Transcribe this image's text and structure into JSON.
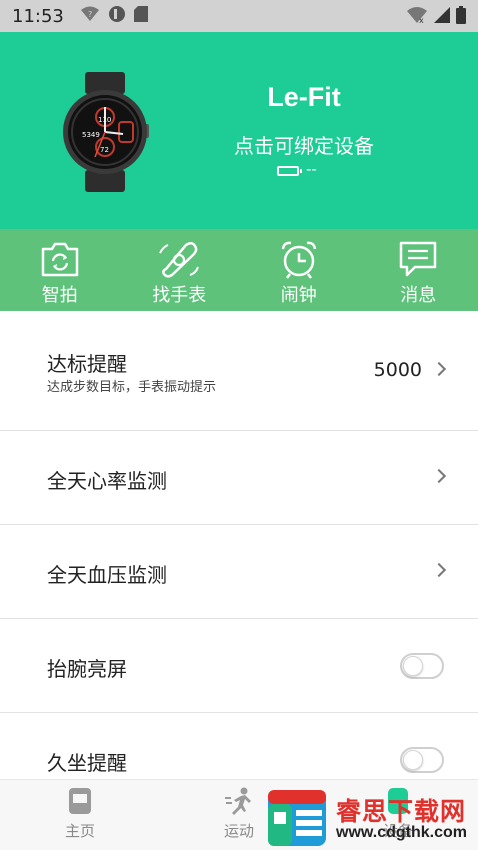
{
  "status_bar": {
    "time": "11:53"
  },
  "header": {
    "title": "Le-Fit",
    "subtitle": "点击可绑定设备",
    "battery_text": "--",
    "watch_face": {
      "top": "110",
      "steps": "5349",
      "bottom": "72"
    },
    "background": "#1ecc95"
  },
  "actions": [
    {
      "label": "智拍",
      "icon": "camera-icon"
    },
    {
      "label": "找手表",
      "icon": "find-watch-icon"
    },
    {
      "label": "闹钟",
      "icon": "alarm-clock-icon"
    },
    {
      "label": "消息",
      "icon": "message-icon"
    }
  ],
  "settings": {
    "goal": {
      "title": "达标提醒",
      "desc": "达成步数目标，手表振动提示",
      "value": "5000"
    },
    "heart_rate": {
      "title": "全天心率监测"
    },
    "blood_pressure": {
      "title": "全天血压监测"
    },
    "wrist_raise": {
      "title": "抬腕亮屏",
      "enabled": false
    },
    "sedentary": {
      "title": "久坐提醒",
      "enabled": false
    }
  },
  "bottom_nav": [
    {
      "label": "主页",
      "icon": "home-icon"
    },
    {
      "label": "运动",
      "icon": "running-icon"
    },
    {
      "label": "设备",
      "icon": "device-icon"
    }
  ],
  "watermark": {
    "text": "睿思下载网",
    "url": "www.cdgthk.com"
  }
}
